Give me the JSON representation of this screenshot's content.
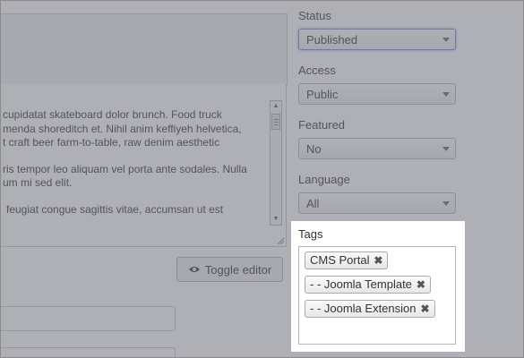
{
  "editor": {
    "paragraphs": [
      [
        "cupidatat skateboard dolor brunch. Food truck",
        "menda shoreditch et. Nihil anim keffiyeh helvetica,",
        "t craft beer farm-to-table, raw denim aesthetic"
      ],
      [
        "ris tempor leo aliquam vel porta ante sodales. Nulla",
        "um mi sed elit."
      ],
      [
        "feugiat congue sagittis vitae, accumsan ut est"
      ]
    ],
    "toggle_label": "Toggle editor"
  },
  "sidebar": {
    "status": {
      "label": "Status",
      "value": "Published"
    },
    "access": {
      "label": "Access",
      "value": "Public"
    },
    "featured": {
      "label": "Featured",
      "value": "No"
    },
    "language": {
      "label": "Language",
      "value": "All"
    },
    "tags": {
      "label": "Tags",
      "items": [
        "CMS Portal",
        "- - Joomla Template",
        "- - Joomla Extension"
      ],
      "remove_glyph": "✖"
    }
  },
  "colors": {
    "overlay": "#6e6e7a",
    "focus_border": "#6b8cc8"
  }
}
